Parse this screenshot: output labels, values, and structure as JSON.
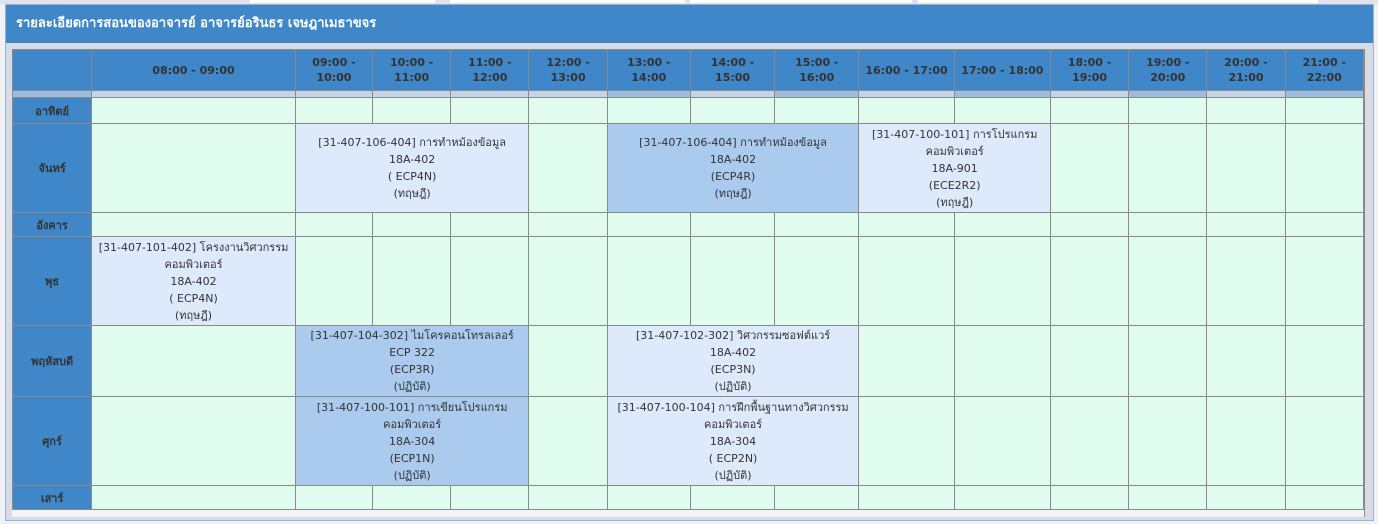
{
  "title": "รายละเอียดการสอนของอาจารย์ อาจารย์อรินธร เจษฎาเมธาขจร",
  "time_headers": [
    [
      "08:00 - 09:00"
    ],
    [
      "09:00 -",
      "10:00"
    ],
    [
      "10:00 -",
      "11:00"
    ],
    [
      "11:00 -",
      "12:00"
    ],
    [
      "12:00 -",
      "13:00"
    ],
    [
      "13:00 -",
      "14:00"
    ],
    [
      "14:00 -",
      "15:00"
    ],
    [
      "15:00 -",
      "16:00"
    ],
    [
      "16:00 - 17:00"
    ],
    [
      "17:00 - 18:00"
    ],
    [
      "18:00 -",
      "19:00"
    ],
    [
      "19:00 -",
      "20:00"
    ],
    [
      "20:00 -",
      "21:00"
    ],
    [
      "21:00 -",
      "22:00"
    ]
  ],
  "days": [
    "อาทิตย์",
    "จันทร์",
    "อังคาร",
    "พุธ",
    "พฤหัสบดี",
    "ศุกร์",
    "เสาร์"
  ],
  "classes": {
    "mon_1": [
      "[31-407-106-404] การทำหม้องข้อมูล",
      "18A-402",
      "( ECP4N)",
      "(ทฤษฎี)"
    ],
    "mon_2": [
      "[31-407-106-404] การทำหม้องข้อมูล",
      "18A-402",
      "(ECP4R)",
      "(ทฤษฎี)"
    ],
    "mon_3": [
      "[31-407-100-101] การโปรแกรม",
      "คอมพิวเตอร์",
      "18A-901",
      "(ECE2R2)",
      "(ทฤษฎี)"
    ],
    "wed_1": [
      "[31-407-101-402] โครงงานวิศวกรรม",
      "คอมพิวเตอร์",
      "18A-402",
      "( ECP4N)",
      "(ทฤษฎี)"
    ],
    "thu_1": [
      "[31-407-104-302] ไมโครคอนโทรลเลอร์",
      "ECP 322",
      "(ECP3R)",
      "(ปฏิบัติ)"
    ],
    "thu_2": [
      "[31-407-102-302] วิศวกรรมซอฟต์แวร์",
      "18A-402",
      "(ECP3N)",
      "(ปฏิบัติ)"
    ],
    "fri_1": [
      "[31-407-100-101] การเขียนโปรแกรม",
      "คอมพิวเตอร์",
      "18A-304",
      "(ECP1N)",
      "(ปฏิบัติ)"
    ],
    "fri_2": [
      "[31-407-100-104] การฝึกพื้นฐานทางวิศวกรรม",
      "คอมพิวเตอร์",
      "18A-304",
      "( ECP2N)",
      "(ปฏิบัติ)"
    ]
  },
  "colors": {
    "header_blue": "#3f87c9",
    "empty_cell": "#e0fcef",
    "class_cell": "#dceafc",
    "class_cell_highlight": "#aacbee"
  }
}
